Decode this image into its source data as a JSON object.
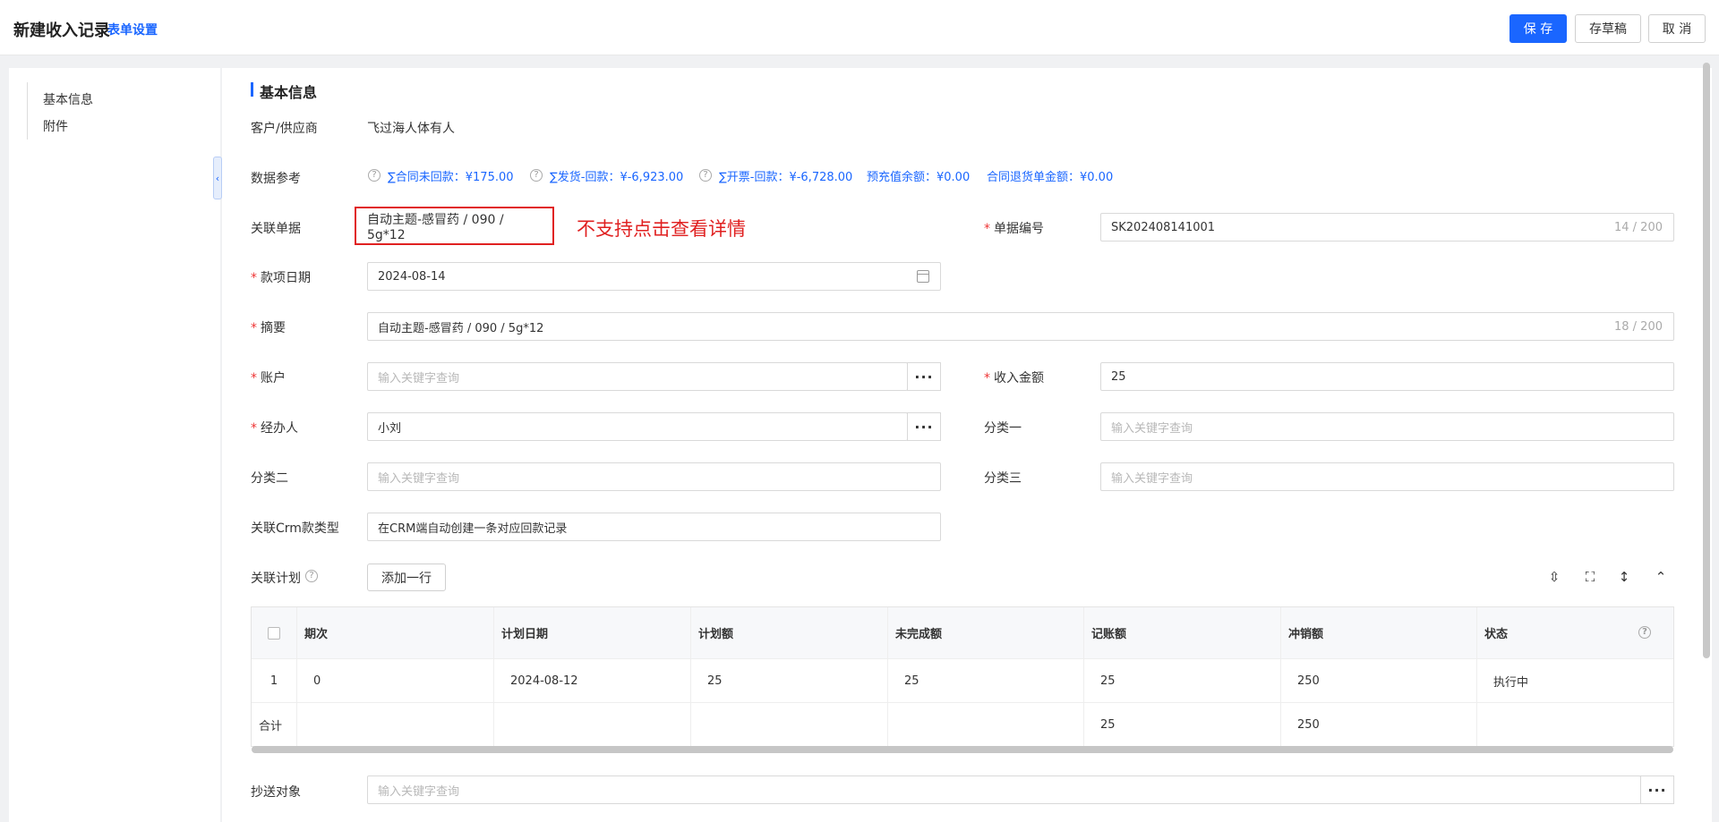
{
  "header": {
    "title": "新建收入记录",
    "form_settings": "表单设置",
    "save": "保 存",
    "draft": "存草稿",
    "cancel": "取 消"
  },
  "nav": {
    "items": [
      "基本信息",
      "附件"
    ]
  },
  "section": {
    "title": "基本信息"
  },
  "fields": {
    "customer_label": "客户/供应商",
    "customer_value": "飞过海人体有人",
    "dataref_label": "数据参考",
    "refs": [
      "∑合同未回款：¥175.00",
      "∑发货-回款：¥-6,923.00",
      "∑开票-回款：¥-6,728.00",
      "预充值余额：¥0.00",
      "合同退货单金额：¥0.00"
    ],
    "related_doc_label": "关联单据",
    "related_doc_value": "自动主题-感冒药 / 090 / 5g*12",
    "annotation": "不支持点击查看详情",
    "doc_no_label": "单据编号",
    "doc_no_value": "SK202408141001",
    "doc_no_count": "14 / 200",
    "date_label": "款项日期",
    "date_value": "2024-08-14",
    "summary_label": "摘要",
    "summary_value": "自动主题-感冒药 / 090 / 5g*12",
    "summary_count": "18 / 200",
    "account_label": "账户",
    "account_placeholder": "输入关键字查询",
    "amount_label": "收入金额",
    "amount_value": "25",
    "handler_label": "经办人",
    "handler_value": "小刘",
    "cat1_label": "分类一",
    "cat1_placeholder": "输入关键字查询",
    "cat2_label": "分类二",
    "cat2_placeholder": "输入关键字查询",
    "cat3_label": "分类三",
    "cat3_placeholder": "输入关键字查询",
    "crm_label": "关联Crm款类型",
    "crm_value": "在CRM端自动创建一条对应回款记录",
    "plan_label": "关联计划",
    "add_row": "添加一行",
    "cc_label": "抄送对象",
    "cc_placeholder": "输入关键字查询",
    "ellipsis": "···"
  },
  "table": {
    "headers": [
      "期次",
      "计划日期",
      "计划额",
      "未完成额",
      "记账额",
      "冲销额",
      "状态"
    ],
    "rows": [
      {
        "idx": "1",
        "cells": [
          "0",
          "2024-08-12",
          "25",
          "25",
          "25",
          "250",
          "执行中"
        ]
      }
    ],
    "total": {
      "label": "合计",
      "cells": [
        "",
        "",
        "",
        "",
        "25",
        "250",
        ""
      ]
    }
  }
}
